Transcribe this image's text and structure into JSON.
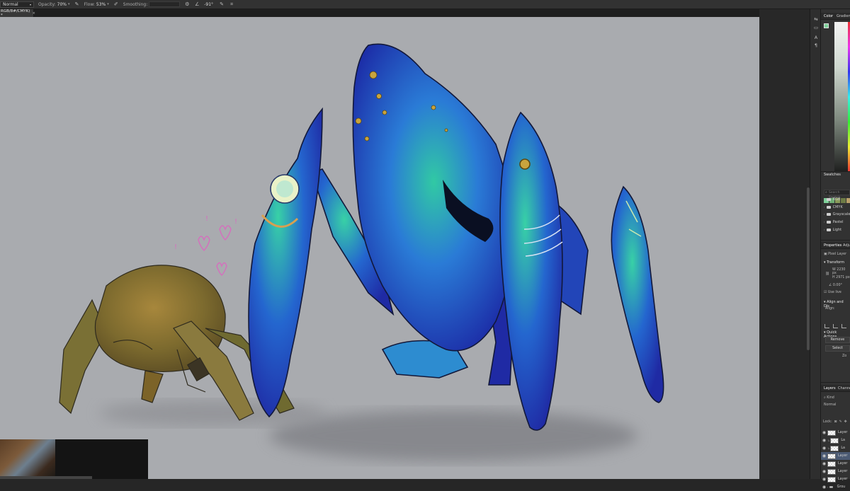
{
  "options_bar": {
    "blend_mode": "Normal",
    "opacity_label": "Opacity:",
    "opacity_value": "70%",
    "flow_label": "Flow:",
    "flow_value": "53%",
    "smoothing_label": "Smoothing:",
    "angle_value": "-91°"
  },
  "document_tab": {
    "title": "RGB/8#/CMYK) *",
    "close": "×"
  },
  "right_panels": {
    "color_tab": "Color",
    "gradients_tab": "Gradient",
    "swatches_title": "Swatches",
    "swatches_search_placeholder": "Search Swatch",
    "swatch_colors": [
      "#7fd19a",
      "#6fae74",
      "#8a9a5a",
      "#6e7c46",
      "#b9a06a",
      "#8c7a55"
    ],
    "swatch_groups": [
      "RGB",
      "CMYK",
      "Grayscale",
      "Pastel",
      "Light"
    ],
    "properties_tab": "Properties",
    "adjustments_tab": "Adju",
    "pixel_layer_label": "Pixel Layer",
    "transform_title": "Transform",
    "w_label": "W",
    "w_value": "2230 px",
    "h_label": "H",
    "h_value": "2971 px",
    "angle_value": "0.00°",
    "use_live_label": "Use live",
    "align_title": "Align and Dis",
    "align_label": "Align:",
    "quick_actions_title": "Quick Actions",
    "remove_bg_label": "Remove",
    "select_label": "Select",
    "more_label": "Zo",
    "layers_tab": "Layers",
    "channels_tab": "Channe",
    "kind_label": "Kind",
    "layers_blend": "Normal",
    "lock_label": "Lock:",
    "layers": [
      {
        "name": "Layer",
        "selected": false,
        "group": false,
        "indent": false
      },
      {
        "name": "La",
        "selected": false,
        "group": false,
        "indent": true
      },
      {
        "name": "La",
        "selected": false,
        "group": false,
        "indent": true
      },
      {
        "name": "Layer",
        "selected": true,
        "group": false,
        "indent": false
      },
      {
        "name": "Layer",
        "selected": false,
        "group": false,
        "indent": false
      },
      {
        "name": "Layer",
        "selected": false,
        "group": false,
        "indent": false
      },
      {
        "name": "Layer",
        "selected": false,
        "group": false,
        "indent": false
      },
      {
        "name": "Grou",
        "selected": false,
        "group": true,
        "indent": false
      }
    ]
  },
  "canvas": {
    "background": "#a9abaf",
    "doodle_marks": [
      "!",
      "!",
      "!"
    ]
  }
}
